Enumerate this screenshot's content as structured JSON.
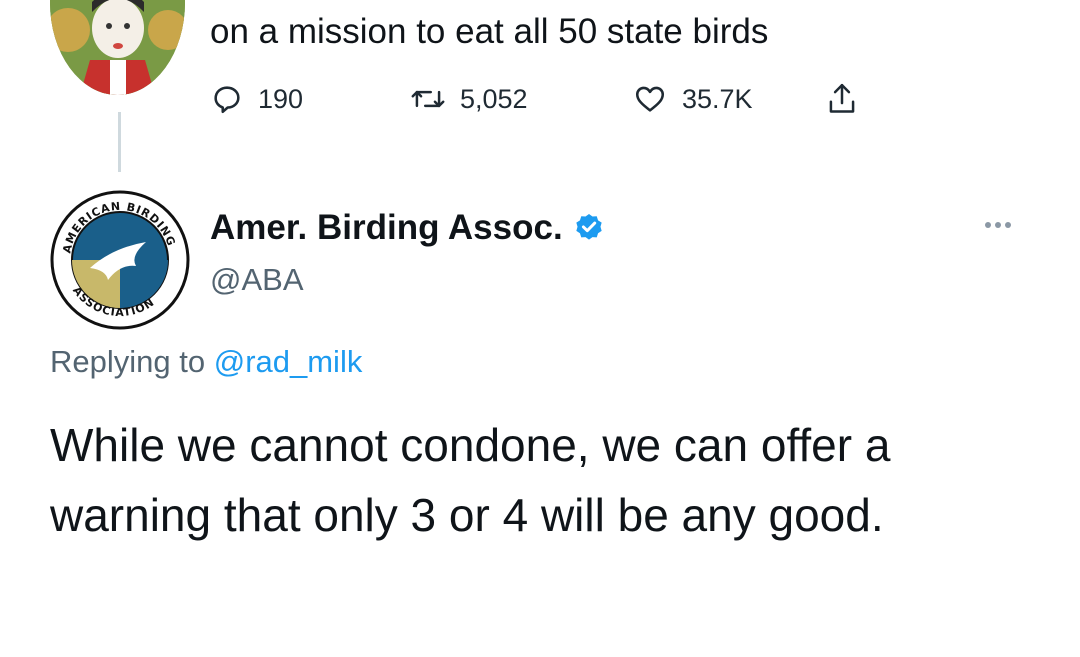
{
  "colors": {
    "text": "#0f1419",
    "secondary": "#536471",
    "link": "#1d9bf0",
    "verified_badge": "#1d9bf0"
  },
  "top_tweet": {
    "text": "on a mission to eat all 50 state birds",
    "actions": {
      "replies": "190",
      "retweets": "5,052",
      "likes": "35.7K"
    },
    "icons": [
      "reply-icon",
      "retweet-icon",
      "like-icon",
      "share-icon"
    ]
  },
  "reply_tweet": {
    "author_name": "Amer. Birding Assoc.",
    "author_handle": "@ABA",
    "avatar_text": "AMERICAN BIRDING ASSOCIATION",
    "replying_prefix": "Replying to",
    "replying_handle": "@rad_milk",
    "text": "While we cannot condone, we can offer a warning that only 3 or 4 will be any good."
  }
}
